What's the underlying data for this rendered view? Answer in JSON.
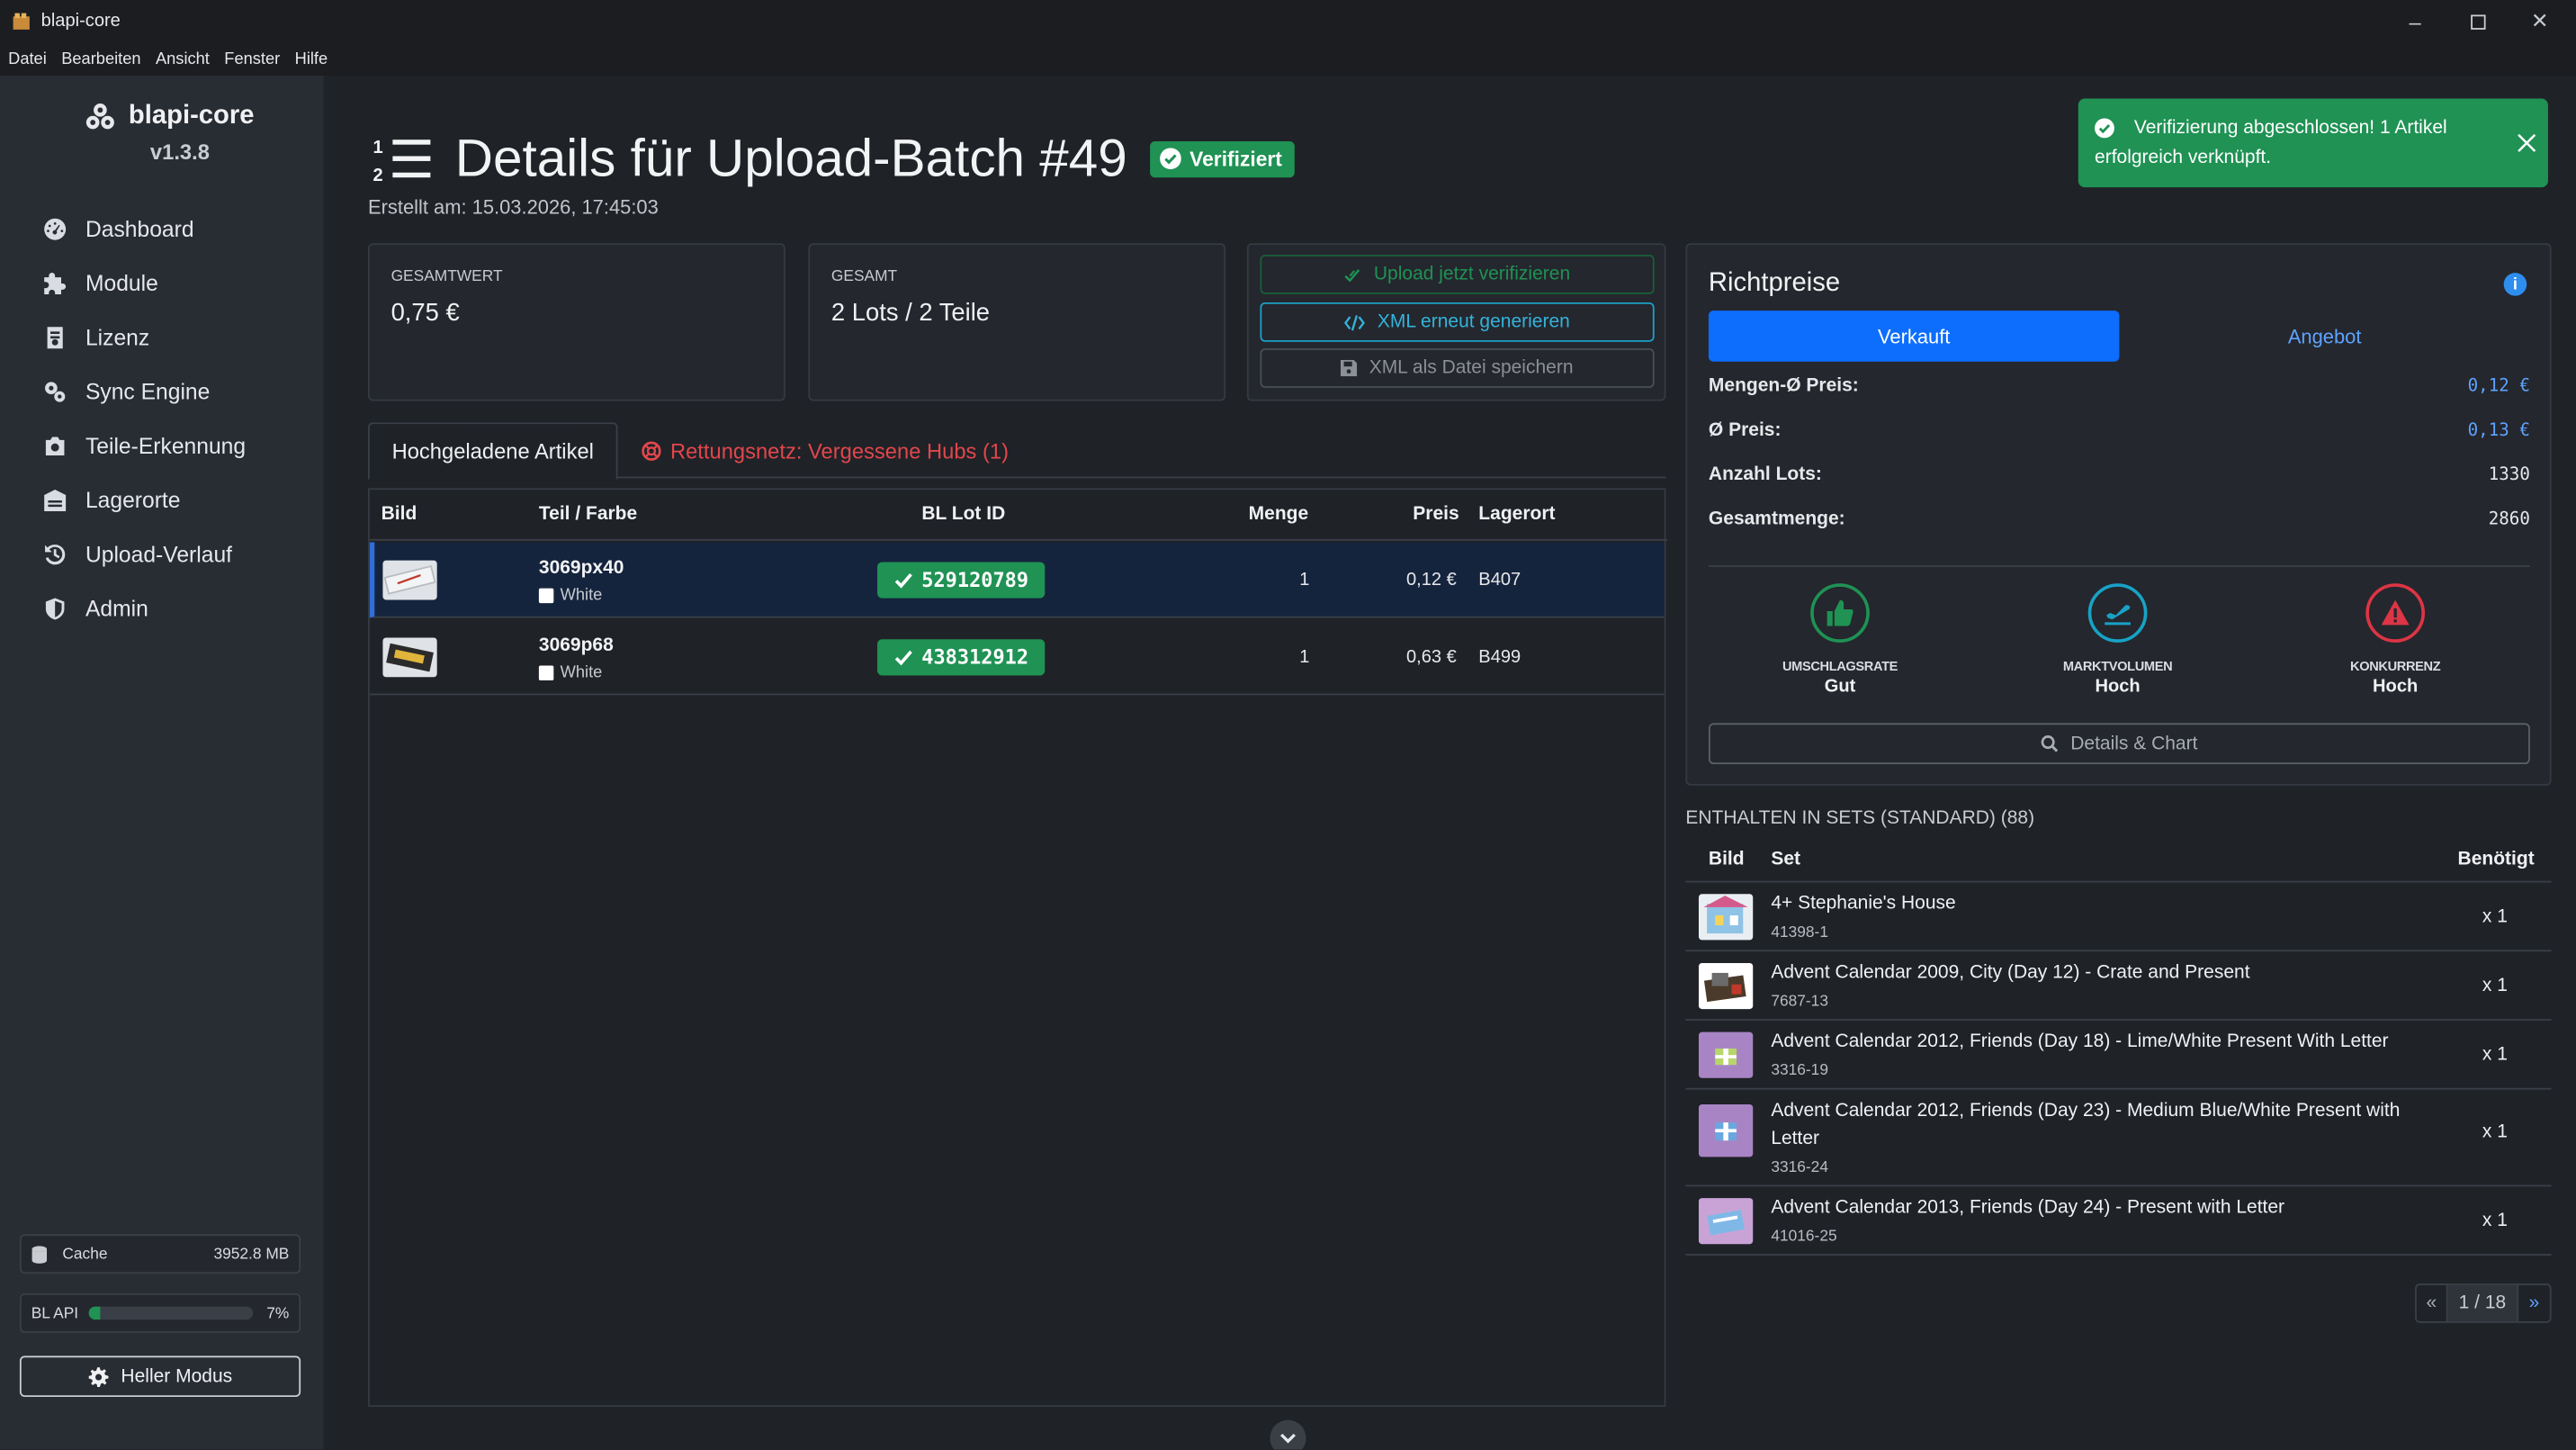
{
  "window": {
    "title": "blapi-core"
  },
  "menu": [
    "Datei",
    "Bearbeiten",
    "Ansicht",
    "Fenster",
    "Hilfe"
  ],
  "sidebar": {
    "app_name": "blapi-core",
    "version": "v1.3.8",
    "items": [
      {
        "label": "Dashboard",
        "icon": "dashboard-icon"
      },
      {
        "label": "Module",
        "icon": "puzzle-icon"
      },
      {
        "label": "Lizenz",
        "icon": "license-icon"
      },
      {
        "label": "Sync Engine",
        "icon": "gears-icon"
      },
      {
        "label": "Teile-Erkennung",
        "icon": "camera-icon"
      },
      {
        "label": "Lagerorte",
        "icon": "warehouse-icon"
      },
      {
        "label": "Upload-Verlauf",
        "icon": "history-icon"
      },
      {
        "label": "Admin",
        "icon": "shield-icon"
      }
    ],
    "cache": {
      "label": "Cache",
      "value": "3952.8 MB"
    },
    "api": {
      "label": "BL API",
      "percent_text": "7%",
      "percent": 7
    },
    "mode_button": "Heller Modus"
  },
  "header": {
    "title": "Details für Upload-Batch #49",
    "status_badge": "Verifiziert",
    "created": "Erstellt am: 15.03.2026, 17:45:03"
  },
  "summary": {
    "total_value_label": "GESAMTWERT",
    "total_value": "0,75 €",
    "total_label": "GESAMT",
    "total": "2 Lots / 2 Teile"
  },
  "actions": {
    "verify": "Upload jetzt verifizieren",
    "regenerate": "XML erneut generieren",
    "save": "XML als Datei speichern"
  },
  "tabs": {
    "uploaded": "Hochgeladene Artikel",
    "safety_net": "Rettungsnetz: Vergessene Hubs (1)"
  },
  "table": {
    "columns": [
      "Bild",
      "Teil / Farbe",
      "BL Lot ID",
      "Menge",
      "Preis",
      "Lagerort"
    ],
    "rows": [
      {
        "part": "3069px40",
        "color": "White",
        "lot_id": "529120789",
        "qty": "1",
        "price": "0,12 €",
        "location": "B407"
      },
      {
        "part": "3069p68",
        "color": "White",
        "lot_id": "438312912",
        "qty": "1",
        "price": "0,63 €",
        "location": "B499"
      }
    ]
  },
  "toast": {
    "text": "Verifizierung abgeschlossen! 1 Artikel erfolgreich verknüpft."
  },
  "prices": {
    "title": "Richtpreise",
    "tab_sold": "Verkauft",
    "tab_offer": "Angebot",
    "rows": [
      {
        "label": "Mengen-Ø Preis:",
        "value": "0,12 €"
      },
      {
        "label": "Ø Preis:",
        "value": "0,13 €"
      },
      {
        "label": "Anzahl Lots:",
        "value": "1330"
      },
      {
        "label": "Gesamtmenge:",
        "value": "2860"
      }
    ],
    "metrics": [
      {
        "label": "UMSCHLAGSRATE",
        "value": "Gut",
        "icon": "thumbs-up-icon",
        "color": "#1f9254"
      },
      {
        "label": "MARKTVOLUMEN",
        "value": "Hoch",
        "icon": "plane-icon",
        "color": "#18a2c6"
      },
      {
        "label": "KONKURRENZ",
        "value": "Hoch",
        "icon": "warning-icon",
        "color": "#dc3545"
      }
    ],
    "details_button": "Details & Chart"
  },
  "sets": {
    "title": "ENTHALTEN IN SETS (STANDARD) (88)",
    "columns": [
      "Bild",
      "Set",
      "Benötigt"
    ],
    "rows": [
      {
        "name": "4+ Stephanie's House",
        "number": "41398-1",
        "qty": "x 1"
      },
      {
        "name": "Advent Calendar 2009, City (Day 12) - Crate and Present",
        "number": "7687-13",
        "qty": "x 1"
      },
      {
        "name": "Advent Calendar 2012, Friends (Day 18) - Lime/White Present With Letter",
        "number": "3316-19",
        "qty": "x 1"
      },
      {
        "name": "Advent Calendar 2012, Friends (Day 23) - Medium Blue/White Present with Letter",
        "number": "3316-24",
        "qty": "x 1"
      },
      {
        "name": "Advent Calendar 2013, Friends (Day 24) - Present with Letter",
        "number": "41016-25",
        "qty": "x 1"
      }
    ],
    "pager": {
      "prev": "«",
      "page": "1 / 18",
      "next": "»"
    }
  }
}
